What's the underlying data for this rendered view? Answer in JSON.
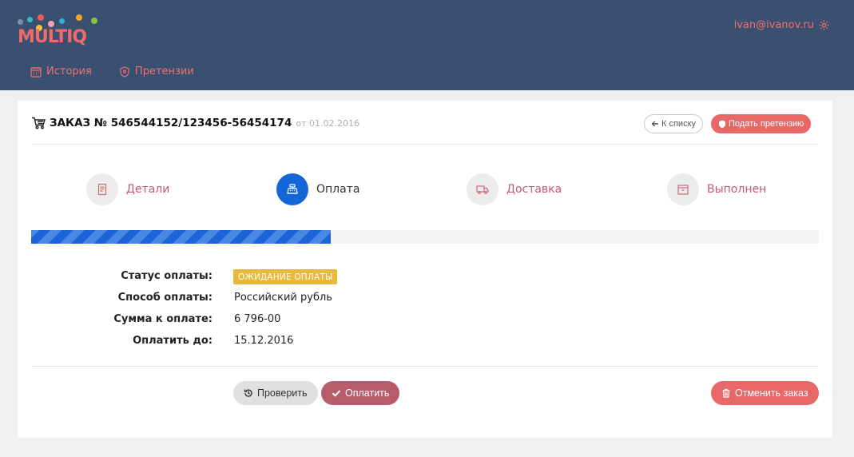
{
  "brand": {
    "logo_text": "MULTIQ"
  },
  "user": {
    "email": "ivan@ivanov.ru",
    "settings_icon": "gear-icon"
  },
  "nav": {
    "items": [
      {
        "label": "История",
        "icon": "calendar-icon"
      },
      {
        "label": "Претензии",
        "icon": "shield-icon"
      }
    ]
  },
  "order": {
    "title": "ЗАКАЗ № 546544152/123456-56454174",
    "date": "от 01.02.2016",
    "back_label": "К списку",
    "claim_label": "Подать претензию"
  },
  "steps": [
    {
      "label": "Детали",
      "icon": "document-icon",
      "active": false
    },
    {
      "label": "Оплата",
      "icon": "cash-register-icon",
      "active": true
    },
    {
      "label": "Доставка",
      "icon": "truck-icon",
      "active": false
    },
    {
      "label": "Выполнен",
      "icon": "box-icon",
      "active": false
    }
  ],
  "progress": {
    "percent": 38
  },
  "payment": {
    "status_label": "Статус оплаты:",
    "status_value": "ОЖИДАНИЕ ОПЛАТЫ",
    "method_label": "Способ оплаты:",
    "method_value": "Российский рубль",
    "amount_label": "Сумма к оплате:",
    "amount_value": "6 796-00",
    "due_label": "Оплатить до:",
    "due_value": "15.12.2016"
  },
  "actions": {
    "check_label": "Проверить",
    "pay_label": "Оплатить",
    "cancel_label": "Отменить заказ"
  },
  "colors": {
    "header_bg": "#3a5070",
    "accent_red": "#e86868",
    "active_blue": "#1466d8",
    "badge_yellow": "#e9b93b",
    "pay_button": "#b85c6c"
  }
}
